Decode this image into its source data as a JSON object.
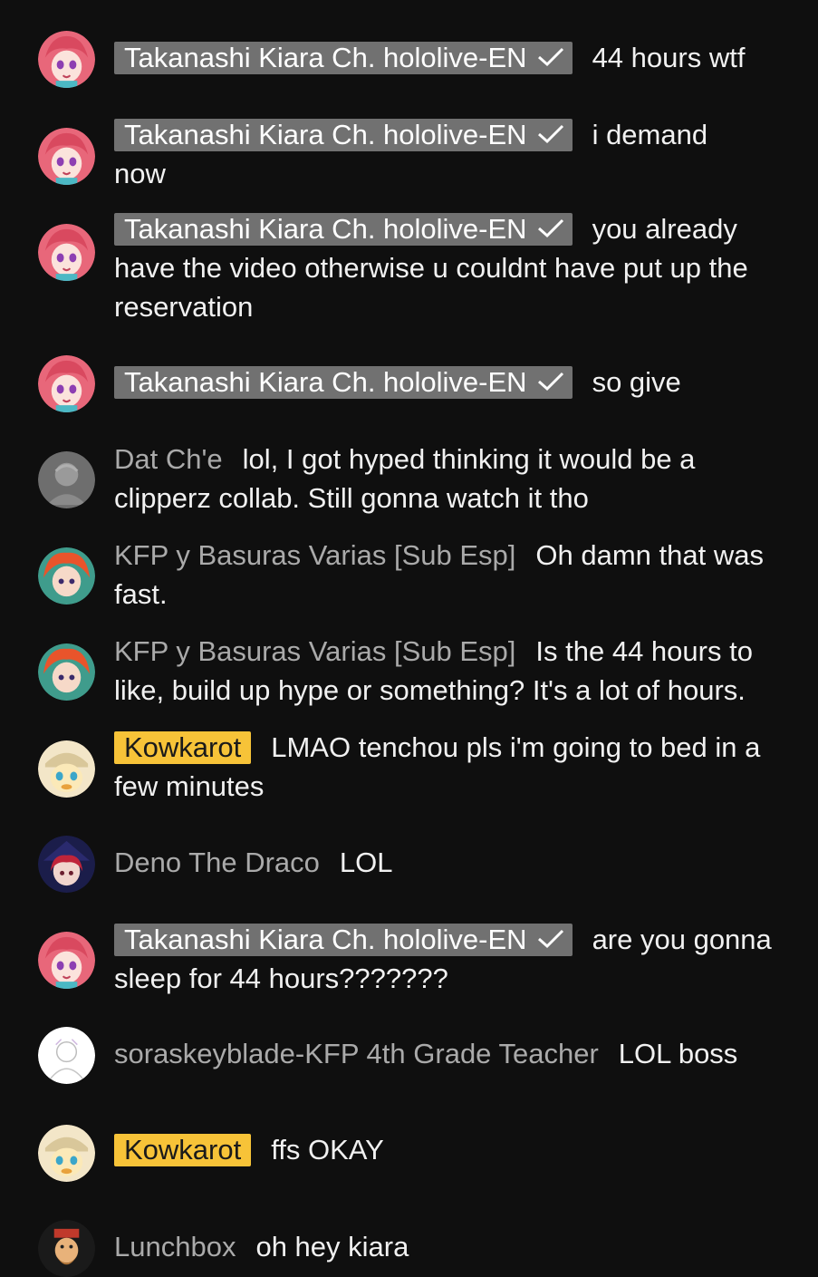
{
  "messages": [
    {
      "author": "Takanashi Kiara Ch. hololive-EN",
      "role": "owner",
      "text": "44 hours wtf",
      "avatar": "kiara"
    },
    {
      "author": "Takanashi Kiara Ch. hololive-EN",
      "role": "owner",
      "text": "i demand now",
      "avatar": "kiara"
    },
    {
      "author": "Takanashi Kiara Ch. hololive-EN",
      "role": "owner",
      "text": "you already have the video otherwise u couldnt have put up the reservation",
      "avatar": "kiara"
    },
    {
      "author": "Takanashi Kiara Ch. hololive-EN",
      "role": "owner",
      "text": "so give",
      "avatar": "kiara"
    },
    {
      "author": "Dat Ch'e",
      "role": "viewer",
      "text": "lol, I got hyped thinking it would be a clipperz collab. Still gonna watch it tho",
      "avatar": "datche"
    },
    {
      "author": "KFP y Basuras Varias [Sub Esp]",
      "role": "viewer",
      "text": "Oh damn that was fast.",
      "avatar": "kfp"
    },
    {
      "author": "KFP y Basuras Varias [Sub Esp]",
      "role": "viewer",
      "text": "Is the 44 hours to like, build up hype or something? It's a lot of hours.",
      "avatar": "kfp"
    },
    {
      "author": "Kowkarot",
      "role": "member",
      "text": "LMAO tenchou pls i'm going to bed in a few minutes",
      "avatar": "kowkarot"
    },
    {
      "author": "Deno The Draco",
      "role": "viewer",
      "text": "LOL",
      "avatar": "deno"
    },
    {
      "author": "Takanashi Kiara Ch. hololive-EN",
      "role": "owner",
      "text": "are you gonna sleep for 44 hours???????",
      "avatar": "kiara"
    },
    {
      "author": "soraskeyblade-KFP 4th Grade Teacher",
      "role": "viewer",
      "text": "LOL boss",
      "avatar": "sora"
    },
    {
      "author": "Kowkarot",
      "role": "member",
      "text": "ffs OKAY",
      "avatar": "kowkarot"
    },
    {
      "author": "Lunchbox",
      "role": "viewer",
      "text": "oh hey kiara",
      "avatar": "lunchbox"
    }
  ],
  "colors": {
    "background": "#0f0f0f",
    "text": "#f1f1f1",
    "author": "#aaaaaa",
    "owner_badge": "#717171",
    "member_badge": "#f7c338"
  },
  "icons": {
    "verified": "checkmark-icon"
  }
}
